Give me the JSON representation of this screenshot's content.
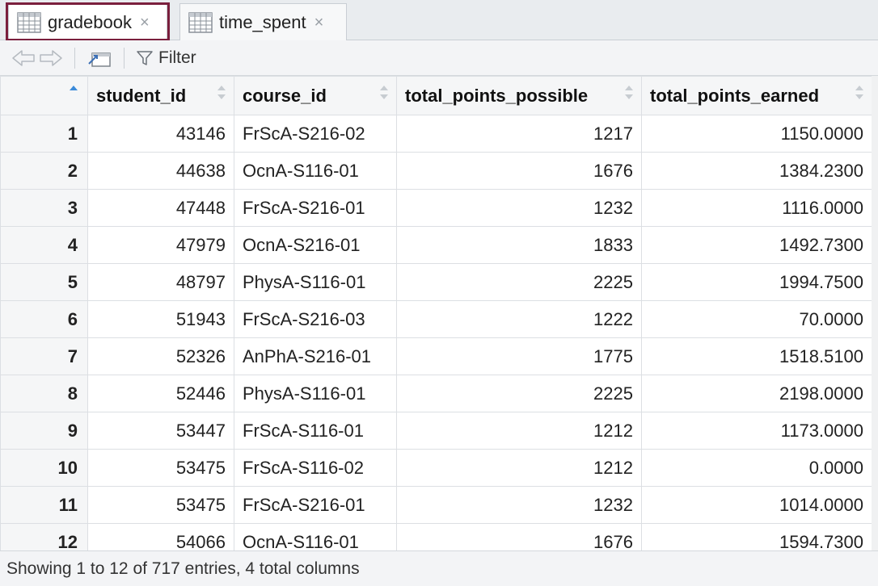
{
  "tabs": [
    {
      "label": "gradebook",
      "active": true
    },
    {
      "label": "time_spent",
      "active": false
    }
  ],
  "toolbar": {
    "filter_label": "Filter"
  },
  "table": {
    "columns": [
      "student_id",
      "course_id",
      "total_points_possible",
      "total_points_earned"
    ],
    "rows": [
      {
        "n": "1",
        "student_id": "43146",
        "course_id": "FrScA-S216-02",
        "possible": "1217",
        "earned": "1150.0000"
      },
      {
        "n": "2",
        "student_id": "44638",
        "course_id": "OcnA-S116-01",
        "possible": "1676",
        "earned": "1384.2300"
      },
      {
        "n": "3",
        "student_id": "47448",
        "course_id": "FrScA-S216-01",
        "possible": "1232",
        "earned": "1116.0000"
      },
      {
        "n": "4",
        "student_id": "47979",
        "course_id": "OcnA-S216-01",
        "possible": "1833",
        "earned": "1492.7300"
      },
      {
        "n": "5",
        "student_id": "48797",
        "course_id": "PhysA-S116-01",
        "possible": "2225",
        "earned": "1994.7500"
      },
      {
        "n": "6",
        "student_id": "51943",
        "course_id": "FrScA-S216-03",
        "possible": "1222",
        "earned": "70.0000"
      },
      {
        "n": "7",
        "student_id": "52326",
        "course_id": "AnPhA-S216-01",
        "possible": "1775",
        "earned": "1518.5100"
      },
      {
        "n": "8",
        "student_id": "52446",
        "course_id": "PhysA-S116-01",
        "possible": "2225",
        "earned": "2198.0000"
      },
      {
        "n": "9",
        "student_id": "53447",
        "course_id": "FrScA-S116-01",
        "possible": "1212",
        "earned": "1173.0000"
      },
      {
        "n": "10",
        "student_id": "53475",
        "course_id": "FrScA-S116-02",
        "possible": "1212",
        "earned": "0.0000"
      },
      {
        "n": "11",
        "student_id": "53475",
        "course_id": "FrScA-S216-01",
        "possible": "1232",
        "earned": "1014.0000"
      },
      {
        "n": "12",
        "student_id": "54066",
        "course_id": "OcnA-S116-01",
        "possible": "1676",
        "earned": "1594.7300"
      }
    ]
  },
  "status": {
    "text": "Showing 1 to 12 of 717 entries, 4 total columns"
  },
  "colors": {
    "highlight": "#7a1f3d",
    "sort_active": "#3b8ad9"
  }
}
